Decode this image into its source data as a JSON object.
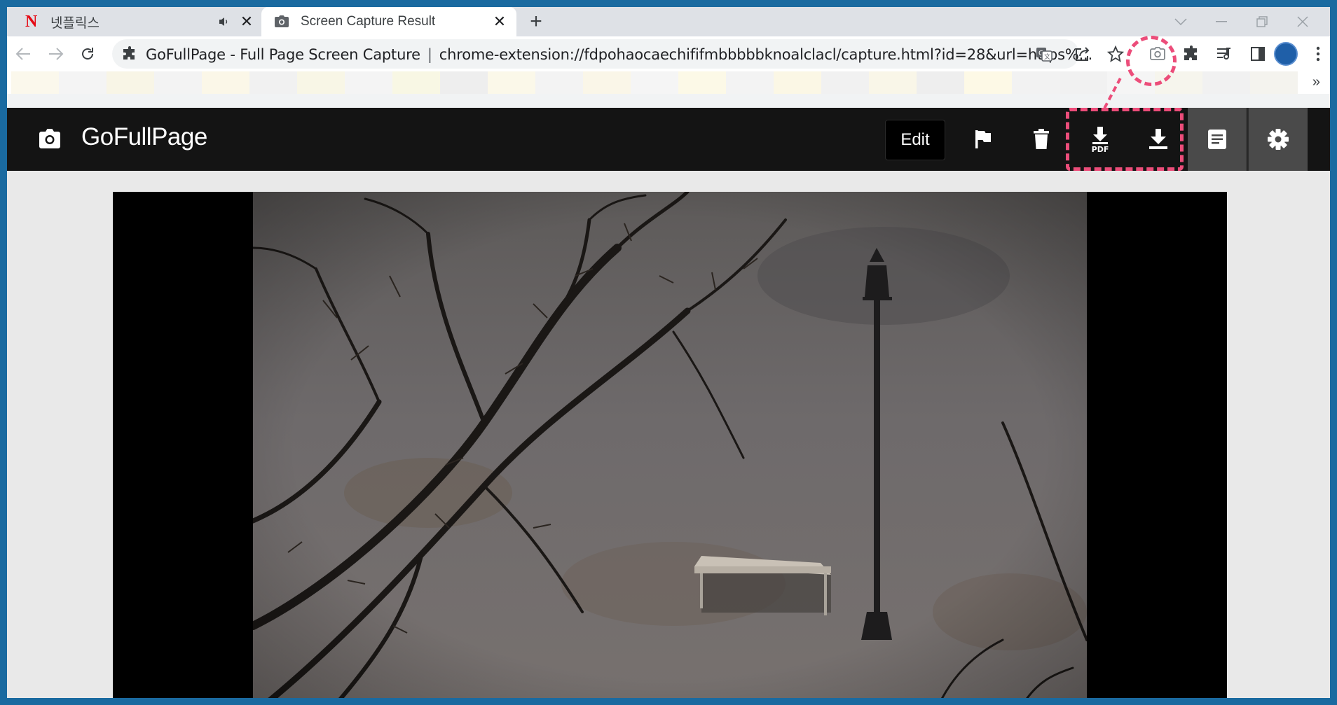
{
  "browser": {
    "tabs": [
      {
        "title": "넷플릭스",
        "active": false,
        "icon": "netflix-icon",
        "audio": true
      },
      {
        "title": "Screen Capture Result",
        "active": true,
        "icon": "camera-icon"
      }
    ],
    "omnibox": {
      "site_name": "GoFullPage - Full Page Screen Capture",
      "separator": "|",
      "url": "chrome-extension://fdpohaocaechififmbbbbbknoalclacl/capture.html?id=28&url=https%..."
    },
    "bookmark_bar_more": "»",
    "bookmark_colors": [
      "#fbf8ec",
      "#f4f4f4",
      "#f8f5e6",
      "#f3f3f3",
      "#fbf7e8",
      "#f1f1f1",
      "#f8f6e6",
      "#f4f4f4",
      "#f8f7e4",
      "#eeeeee",
      "#fbf8e9",
      "#f3f3f3",
      "#faf6e8",
      "#f5f5f5",
      "#fcf9e7",
      "#f3f3f3",
      "#fbf7e5",
      "#f1f1f1",
      "#f9f6e8",
      "#eeeeee",
      "#fdf9e6",
      "#f2f2f2",
      "#f1f1f1",
      "#f5f5f5",
      "#f6f5ed",
      "#f1f1f1",
      "#f4f3ee"
    ]
  },
  "app": {
    "name": "GoFullPage",
    "edit_label": "Edit",
    "buttons": [
      "flag-icon",
      "trash-icon",
      "download-pdf-icon",
      "download-image-icon",
      "notes-icon",
      "settings-icon"
    ],
    "pdf_icon_text": "PDF"
  },
  "colors": {
    "highlight": "#ec4d7a",
    "header_bg": "#141414",
    "frame": "#1a6aa0"
  }
}
